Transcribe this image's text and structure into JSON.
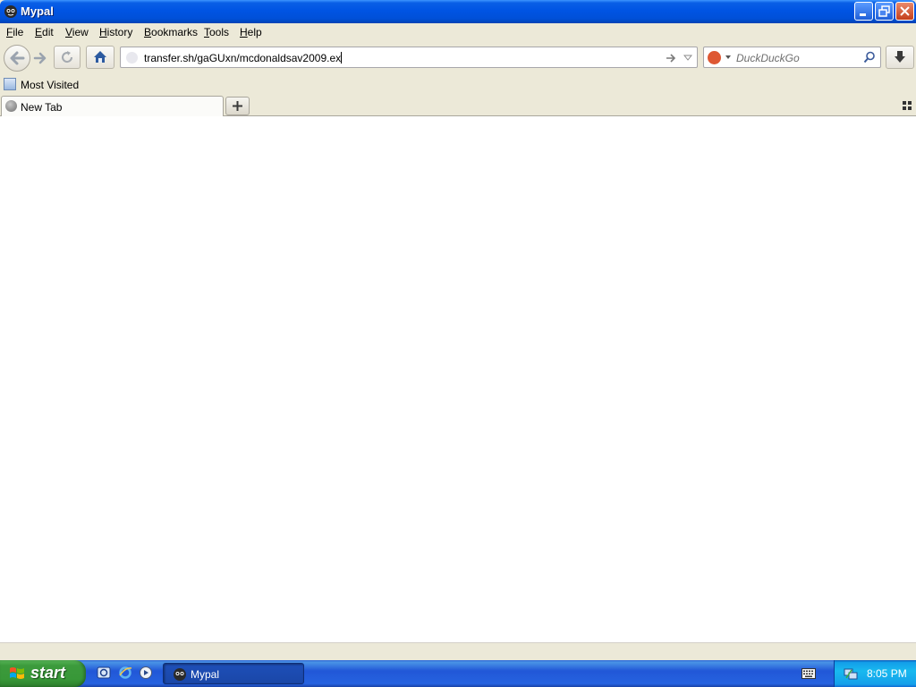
{
  "window": {
    "title": "Mypal"
  },
  "menubar": {
    "items": [
      {
        "label": "File",
        "accesskey": "F",
        "rest": "ile"
      },
      {
        "label": "Edit",
        "accesskey": "E",
        "rest": "dit"
      },
      {
        "label": "View",
        "accesskey": "V",
        "rest": "iew"
      },
      {
        "label": "History",
        "accesskey": "H",
        "rest": "istory"
      },
      {
        "label": "Bookmarks",
        "accesskey": "B",
        "rest": "ookmarks"
      },
      {
        "label": "Tools",
        "accesskey": "T",
        "rest": "ools"
      },
      {
        "label": "Help",
        "accesskey": "H",
        "rest": "elp"
      }
    ]
  },
  "navbar": {
    "url": "transfer.sh/gaGUxn/mcdonaldsav2009.ex",
    "search_placeholder": "DuckDuckGo"
  },
  "bookmarks": {
    "items": [
      {
        "label": "Most Visited"
      }
    ]
  },
  "tabs": [
    {
      "label": "New Tab",
      "active": true
    }
  ],
  "taskbar": {
    "start_label": "start",
    "window_buttons": [
      {
        "label": "Mypal"
      }
    ],
    "clock": "8:05 PM"
  },
  "colors": {
    "titlebar": "#0054e3",
    "chrome": "#ece9d8",
    "taskbar": "#245edb",
    "start": "#3c9a3c",
    "tray": "#18b9ef"
  }
}
